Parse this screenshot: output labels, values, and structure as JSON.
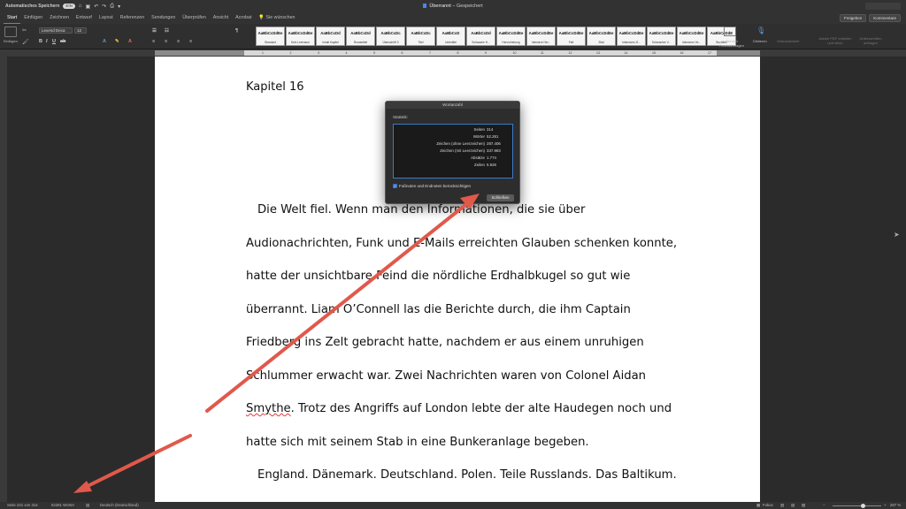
{
  "titlebar": {
    "autosave_label": "Automatisches Speichern",
    "autosave_state": "EIN",
    "doc_title": "Überrannt",
    "doc_status": "Gespeichert",
    "qa_icons": [
      "home-icon",
      "save-icon",
      "undo-icon",
      "redo-icon",
      "print-icon",
      "more-icon"
    ]
  },
  "tabs": [
    "Start",
    "Einfügen",
    "Zeichnen",
    "Entwurf",
    "Layout",
    "Referenzen",
    "Sendungen",
    "Überprüfen",
    "Ansicht",
    "Acrobat",
    "Sie wünschen"
  ],
  "active_tab": "Start",
  "share_label": "Freigeben",
  "comments_label": "Kommentare",
  "ribbon": {
    "paste_label": "Einfügen",
    "font_name": "Lexend Deca",
    "font_size": "12",
    "styles": [
      {
        "sample": "AaBbCcDdEe",
        "name": "Standard"
      },
      {
        "sample": "AaBbCcDdEe",
        "name": "Kein Leerraum"
      },
      {
        "sample": "AaBbCcDd",
        "name": "Inhalt Kapitel"
      },
      {
        "sample": "AaBbCcDd",
        "name": "Romantitel"
      },
      {
        "sample": "AaBbCcDc",
        "name": "Überschrift 3"
      },
      {
        "sample": "AaBbCcDc",
        "name": "Titel"
      },
      {
        "sample": "AaBbCcD",
        "name": "Untertitel"
      },
      {
        "sample": "AaBbCcDd",
        "name": "Schwache H..."
      },
      {
        "sample": "AaBbCcDdEe",
        "name": "Hervorhebung"
      },
      {
        "sample": "AaBbCcDdEe",
        "name": "Intensive Her..."
      },
      {
        "sample": "AaBbCcDdEe",
        "name": "Fett"
      },
      {
        "sample": "AaBbCcDdEe",
        "name": "Zitat"
      },
      {
        "sample": "AaBbCcDdEe",
        "name": "Intensives Zi..."
      },
      {
        "sample": "AaBbCcDdEe",
        "name": "Schwacher V..."
      },
      {
        "sample": "AaBbCcDdEe",
        "name": "Intensiver Ve..."
      },
      {
        "sample": "AaBbCcDdE",
        "name": "Buchtitel"
      }
    ],
    "styles_pane_label": "Bereich Formatvorlagen",
    "dictate_label": "Diktieren",
    "feedback_label": "Vertraulichkeit",
    "pdf_label": "Adobe PDF erstellen und teilen",
    "sign_label": "Unterschriften anfragen"
  },
  "ruler_numbers": [
    "1",
    "2",
    "3",
    "4",
    "5",
    "6",
    "7",
    "8",
    "9",
    "10",
    "11",
    "12",
    "13",
    "14",
    "15",
    "16",
    "17"
  ],
  "document": {
    "heading": "Kapitel 16",
    "lines": [
      "Die Welt fiel. Wenn man den Informationen, die sie über",
      "Audionachrichten, Funk und E-Mails erreichten Glauben schenken konnte,",
      "hatte der unsichtbare Feind die nördliche Erdhalbkugel so gut wie",
      "überrannt. Liam O’Connell las die Berichte durch, die ihm Captain",
      "Friedberg ins Zelt gebracht hatte, nachdem er aus einem unruhigen",
      "Schlummer erwacht war. Zwei Nachrichten waren von Colonel Aidan",
      "Smythe",
      ". Trotz des Angriffs auf London lebte der alte Haudegen noch und",
      "hatte sich mit seinem Stab in eine Bunkeranlage begeben.",
      "England. Dänemark. Deutschland. Polen. Teile Russlands. Das Baltikum."
    ]
  },
  "dialog": {
    "title": "Wortanzahl",
    "section_label": "Statistik:",
    "stats": [
      {
        "label": "Seiten",
        "value": "314"
      },
      {
        "label": "Wörter",
        "value": "52.281"
      },
      {
        "label": "Zeichen (ohne Leerzeichen)",
        "value": "287.406"
      },
      {
        "label": "Zeichen (mit Leerzeichen)",
        "value": "337.983"
      },
      {
        "label": "Absätze",
        "value": "1.774"
      },
      {
        "label": "Zeilen",
        "value": "5.926"
      }
    ],
    "checkbox_label": "Fußnoten und Endnoten berücksichtigen",
    "close_label": "Schließen"
  },
  "statusbar": {
    "page": "Seite 221 von 314",
    "words": "52281 Wörter",
    "language": "Deutsch (Deutschland)",
    "focus": "Fokus",
    "zoom": "287 %"
  },
  "colors": {
    "arrow": "#e0594b",
    "accent": "#3d79c7",
    "squiggle": "#e23a3a"
  }
}
